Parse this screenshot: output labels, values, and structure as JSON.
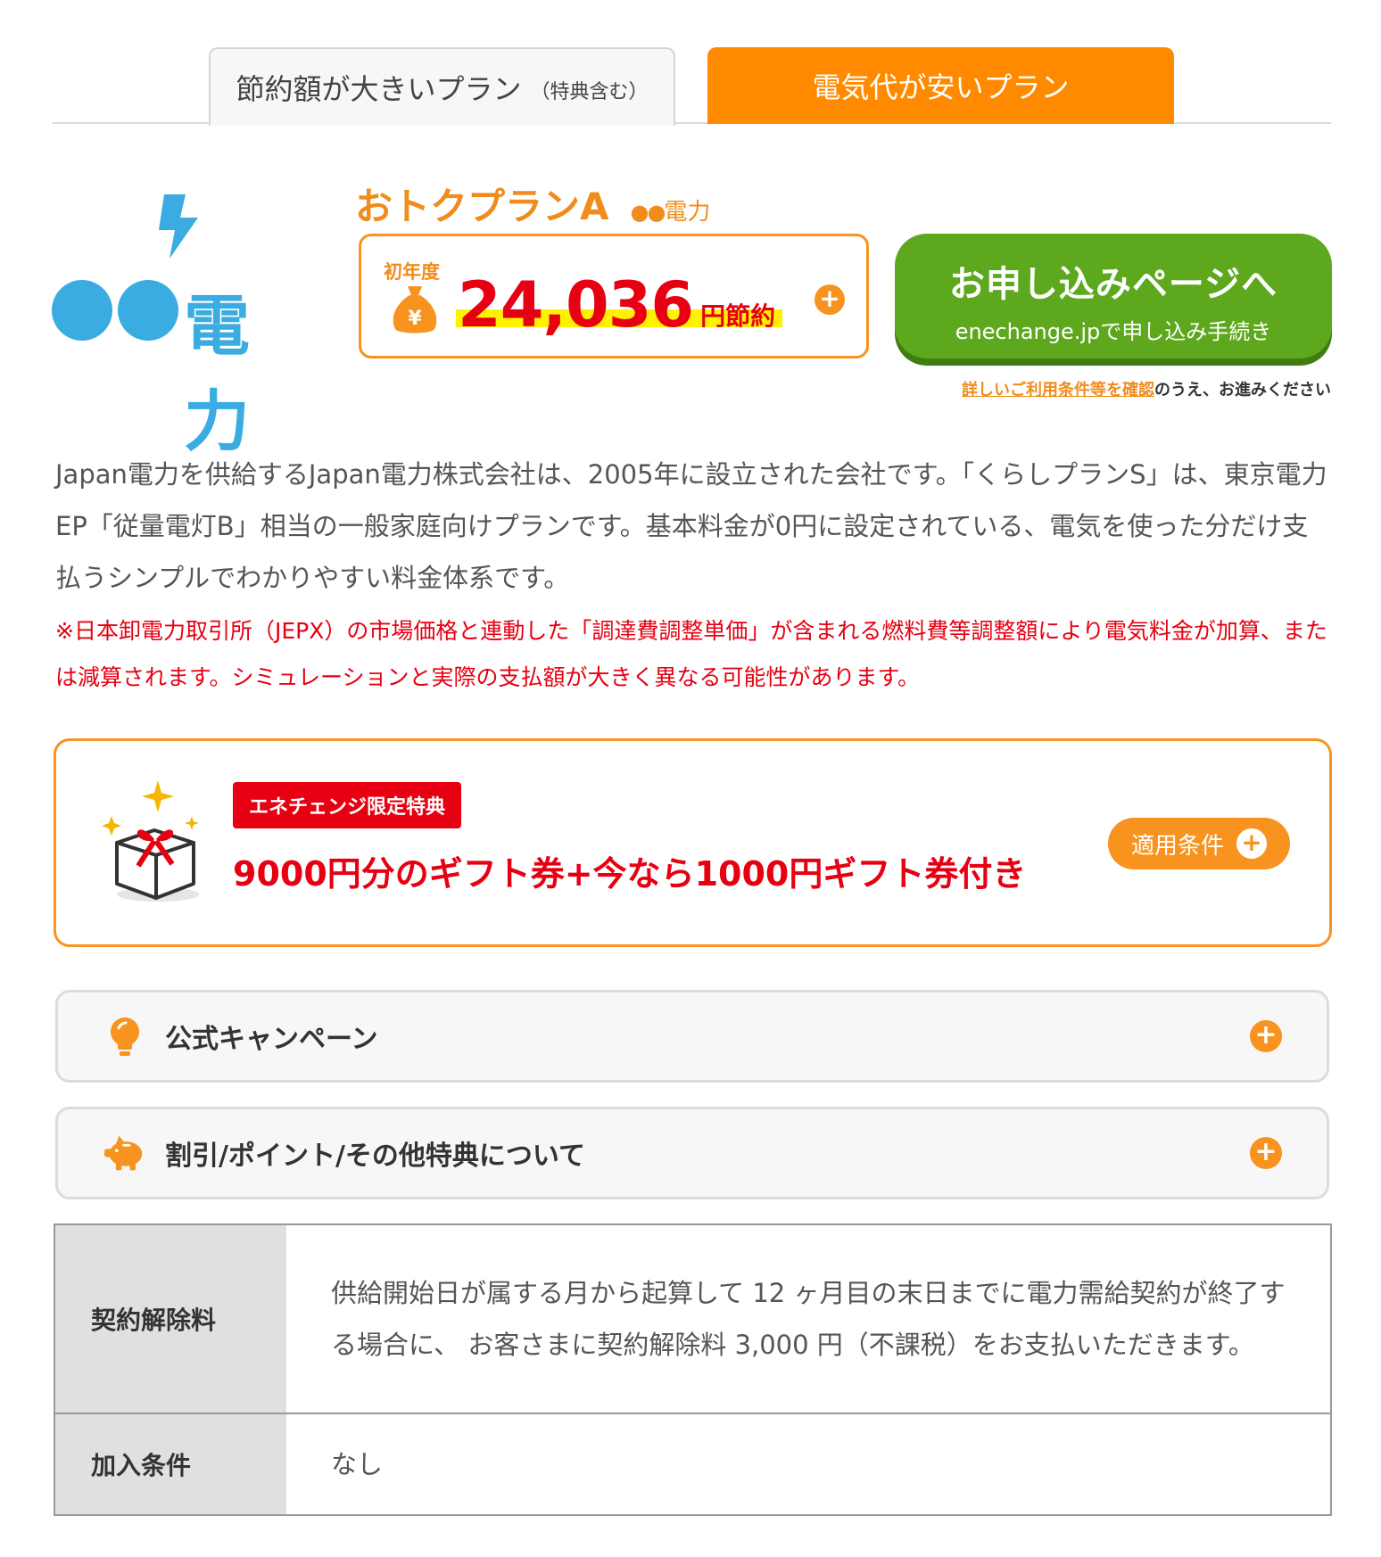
{
  "tabs": {
    "savings_label": "節約額が大きいプラン",
    "savings_note": "（特典含む）",
    "cheap_label": "電気代が安いプラン"
  },
  "provider": {
    "logo_dots": "●●",
    "logo_text": "電力",
    "brand_color": "#3aace2"
  },
  "plan": {
    "name": "おトクプランA",
    "provider_dots": "●●",
    "provider_suffix": "電力"
  },
  "savings": {
    "period": "初年度",
    "amount": "24,036",
    "unit": "円節約",
    "expand_icon": "plus-circle-icon"
  },
  "apply": {
    "title": "お申し込みページへ",
    "subtitle": "enechange.jpで申し込み手続き"
  },
  "terms_note": {
    "link": "詳しいご利用条件等を確認",
    "suffix": "のうえ、お進みください"
  },
  "description": "Japan電力を供給するJapan電力株式会社は、2005年に設立された会社です。「くらしプランS」は、東京電力EP「従量電灯B」相当の一般家庭向けプランです。基本料金が0円に設定されている、電気を使った分だけ支払うシンプルでわかりやすい料金体系です。",
  "warning": "※日本卸電力取引所（JEPX）の市場価格と連動した「調達費調整単価」が含まれる燃料費等調整額により電気料金が加算、または減算されます。シミュレーションと実際の支払額が大きく異なる可能性があります。",
  "benefit": {
    "tag": "エネチェンジ限定特典",
    "text": "9000円分のギフト券+今なら1000円ギフト券付き",
    "conditions_label": "適用条件"
  },
  "accordions": [
    {
      "label": "公式キャンペーン",
      "icon": "lightbulb-icon"
    },
    {
      "label": "割引/ポイント/その他特典について",
      "icon": "piggy-bank-icon"
    }
  ],
  "table": [
    {
      "header": "契約解除料",
      "value": "供給開始日が属する月から起算して 12 ヶ月目の末日までに電力需給契約が終了する場合に、 お客さまに契約解除料 3,000 円（不課税）をお支払いただきます。"
    },
    {
      "header": "加入条件",
      "value": "なし"
    }
  ],
  "colors": {
    "accent_orange": "#f7931e",
    "red": "#e60012",
    "green": "#5ea81e"
  }
}
